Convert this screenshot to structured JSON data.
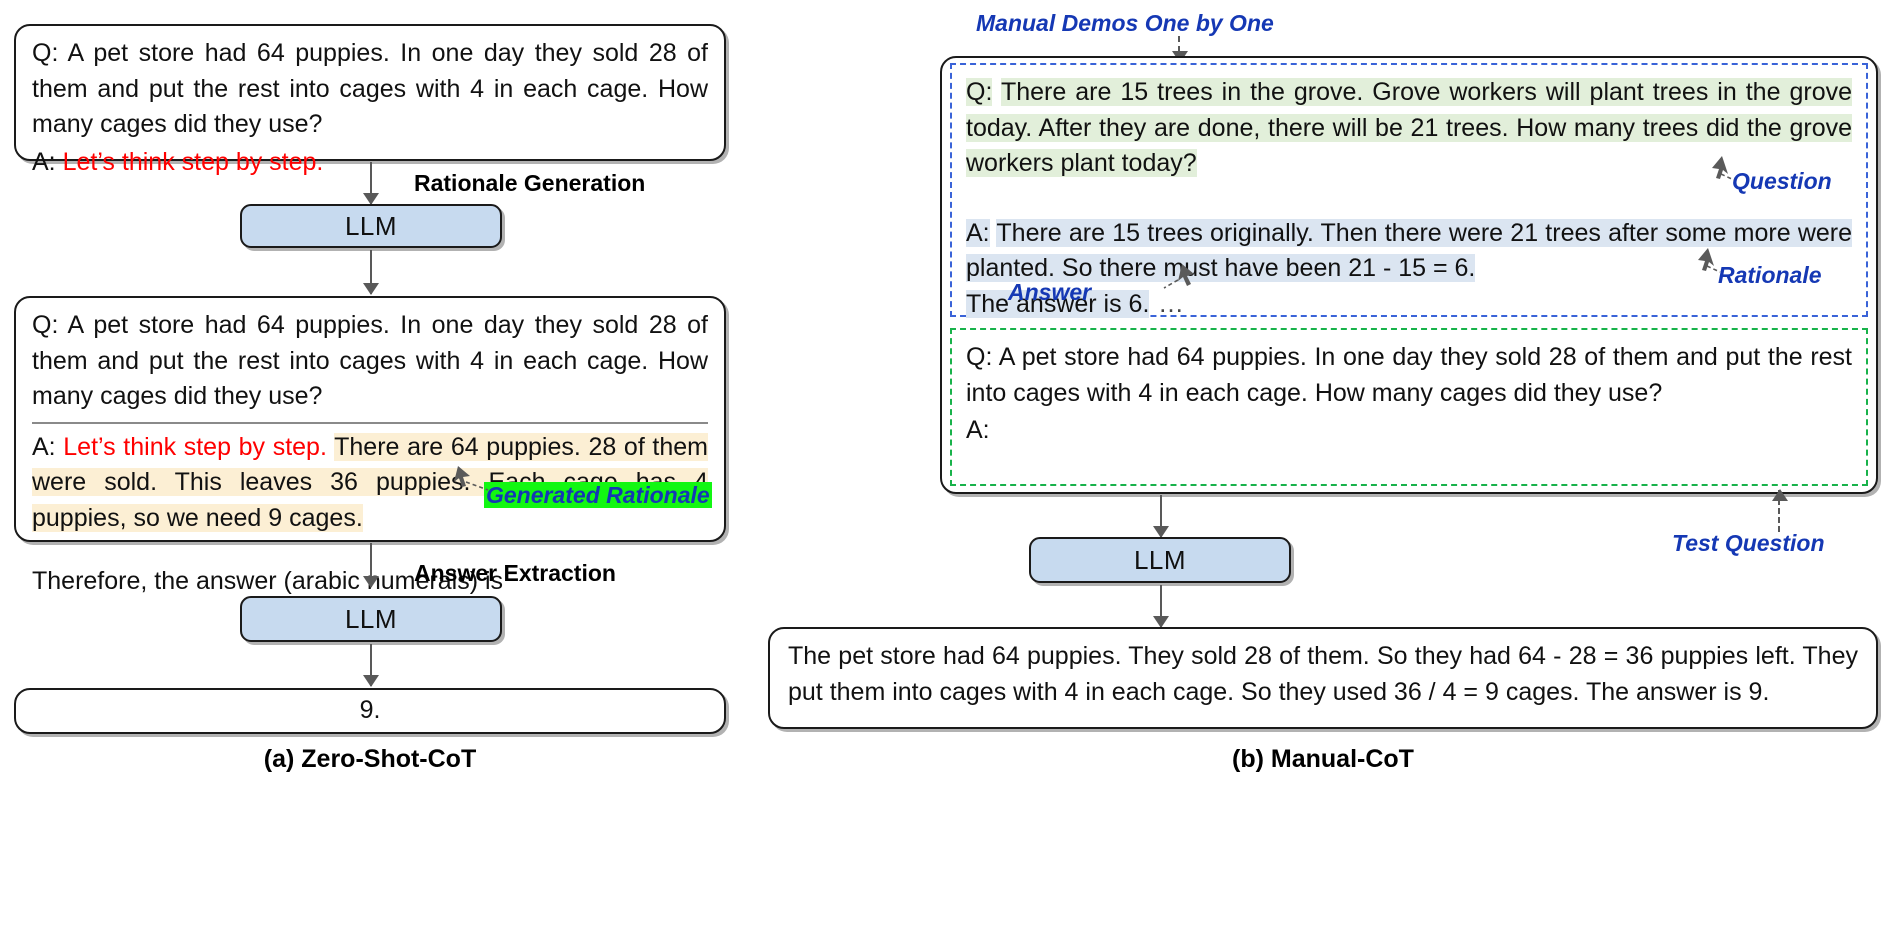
{
  "figure": {
    "panel_a": {
      "caption": "(a) Zero-Shot-CoT",
      "prompt_box1": {
        "question_prefix": "Q:",
        "question": "A pet store had 64 puppies. In one day they sold 28 of them and put the rest into cages with 4 in each cage. How many cages did they use?",
        "answer_prefix": "A:",
        "trigger": "Let’s think step by step."
      },
      "step1_label": "Rationale Generation",
      "llm1": "LLM",
      "prompt_box2": {
        "question_prefix": "Q:",
        "question": "A pet store had 64 puppies. In one day they sold 28 of them and put the rest into cages with 4 in each cage. How many cages did they use?",
        "answer_prefix": "A:",
        "trigger": "Let’s think step by step.",
        "generated_rationale": "There are 64 puppies. 28 of them were sold. This leaves 36 puppies. Each cage has 4 puppies, so we need 9 cages.",
        "rationale_callout": "Generated Rationale",
        "answer_trigger": "Therefore, the answer (arabic numerals) is"
      },
      "step2_label": "Answer Extraction",
      "llm2": "LLM",
      "output": "9."
    },
    "panel_b": {
      "caption": "(b) Manual-CoT",
      "demos_label": "Manual Demos One by One",
      "demo": {
        "question_prefix": "Q:",
        "question": "There are 15 trees in the grove. Grove workers will plant trees in the grove today. After they are done, there will be 21 trees. How many trees did the grove workers plant today?",
        "question_callout": "Question",
        "answer_prefix": "A:",
        "rationale": "There are 15 trees originally. Then there were 21 trees after some more were planted. So there must have been 21 - 15 = 6.",
        "answer": "The answer is 6.",
        "answer_callout": "Answer",
        "rationale_callout": "Rationale",
        "ellipsis": "…"
      },
      "test": {
        "question_prefix": "Q:",
        "question": "A pet store had 64 puppies. In one day they sold 28 of them and put the rest into cages with 4 in each cage. How many cages did they use?",
        "answer_prefix": "A:",
        "callout": "Test Question"
      },
      "llm": "LLM",
      "output": "The pet store had 64 puppies. They sold 28 of them. So they had 64 - 28 = 36 puppies left. They put them into cages with 4 in each cage. So they used 36 / 4 = 9 cages. The answer is 9."
    }
  },
  "colors": {
    "llm_fill": "#c7daef",
    "trigger_red": "#ff0000",
    "rationale_cream": "#fcefd4",
    "callout_green": "#12f712",
    "label_blue": "#1538b4",
    "demo_question_green": "#e2efda",
    "demo_answer_blue": "#dbe5f1",
    "dash_blue": "#3a63d8",
    "dash_green": "#18b24a"
  }
}
